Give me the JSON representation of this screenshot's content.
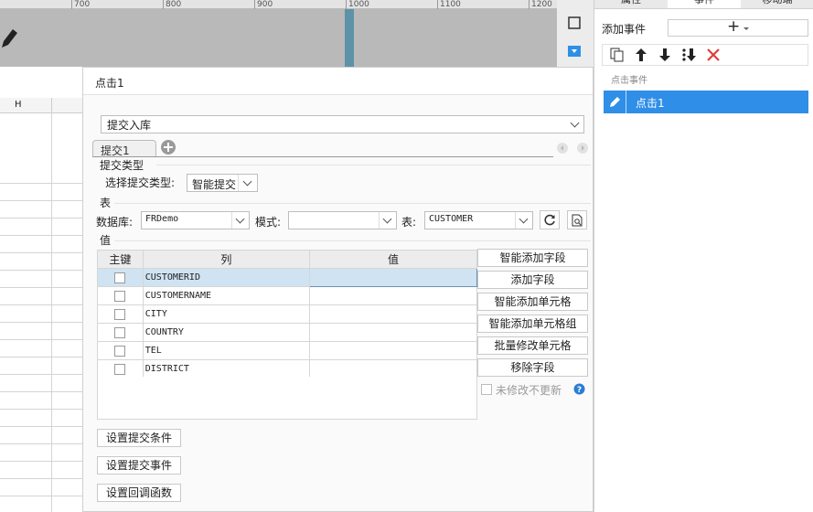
{
  "ruler": {
    "ticks": [
      "700",
      "800",
      "900",
      "1000",
      "1100",
      "1200"
    ]
  },
  "sheet": {
    "column_header": "H"
  },
  "right_panel": {
    "tabs": [
      "属性",
      "事件",
      "移动端"
    ],
    "add_event_label": "添加事件",
    "add_symbol": "+",
    "event_group_label": "点击事件",
    "event_item": "点击1"
  },
  "dialog": {
    "title": "点击1",
    "action_type": "提交入库",
    "tab_label": "提交1",
    "section_submit_type": "提交类型",
    "submit_type_label": "选择提交类型:",
    "submit_type_value": "智能提交",
    "section_table": "表",
    "db_label": "数据库:",
    "db_value": "FRDemo",
    "mode_label": "模式:",
    "mode_value": "",
    "table_label": "表:",
    "table_value": "CUSTOMER",
    "section_value": "值",
    "columns": [
      "主键",
      "列",
      "值"
    ],
    "rows": [
      {
        "column": "CUSTOMERID",
        "value": ""
      },
      {
        "column": "CUSTOMERNAME",
        "value": ""
      },
      {
        "column": "CITY",
        "value": ""
      },
      {
        "column": "COUNTRY",
        "value": ""
      },
      {
        "column": "TEL",
        "value": ""
      },
      {
        "column": "DISTRICT",
        "value": ""
      }
    ],
    "side_buttons": [
      "智能添加字段",
      "添加字段",
      "智能添加单元格",
      "智能添加单元格组",
      "批量修改单元格",
      "移除字段"
    ],
    "unchanged_label": "未修改不更新",
    "bottom_buttons": [
      "设置提交条件",
      "设置提交事件",
      "设置回调函数"
    ]
  },
  "colors": {
    "selected_blue": "#2f8ee8",
    "delete_red": "#e23b3b",
    "row_highlight": "#cfe3f2",
    "help_blue": "#2a7ed3"
  }
}
